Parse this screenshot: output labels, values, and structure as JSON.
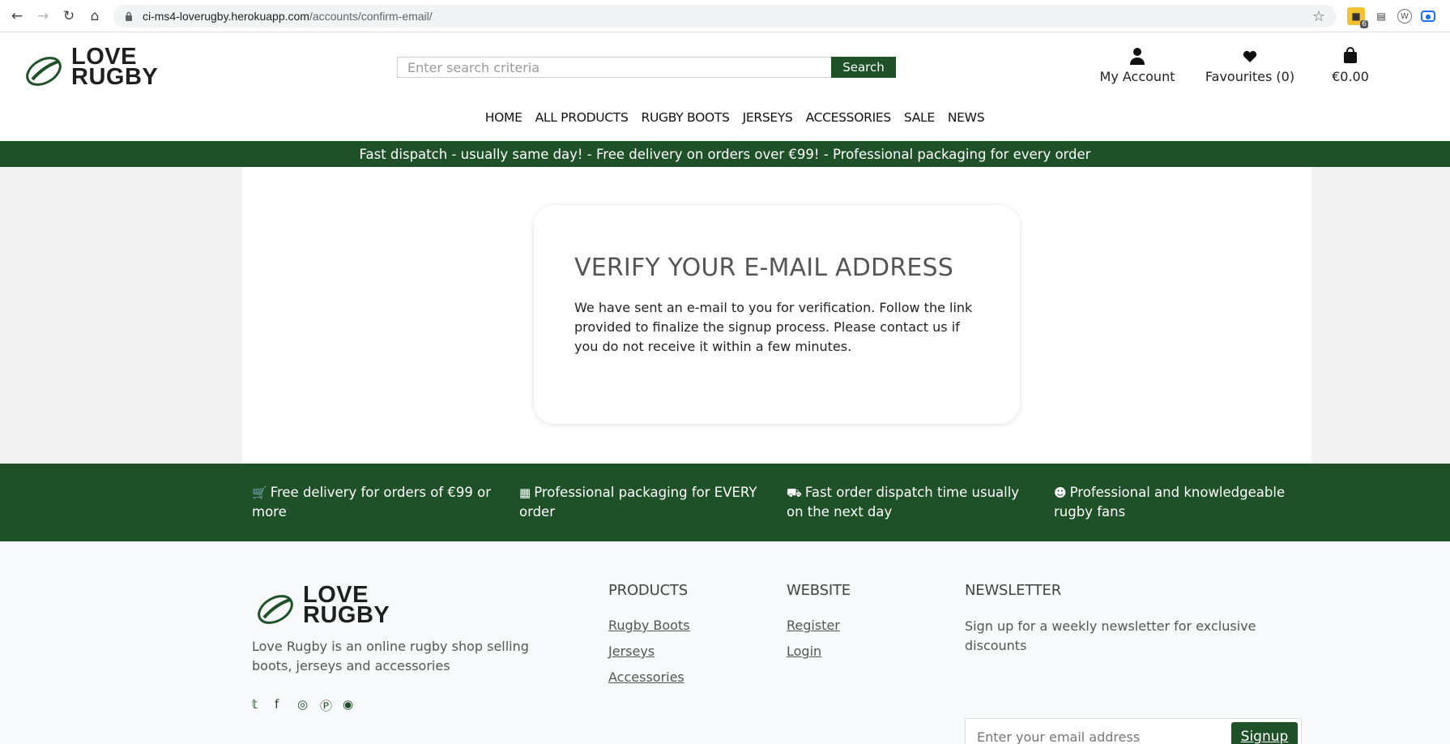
{
  "browser": {
    "url_host": "ci-ms4-loverugby.herokuapp.com",
    "url_path": "/accounts/confirm-email/",
    "ext_badge": "6"
  },
  "brand": {
    "line1": "LOVE",
    "line2": "RUGBY",
    "primary_color": "#1f5128"
  },
  "header": {
    "search_placeholder": "Enter search criteria",
    "search_button": "Search",
    "account_label": "My Account",
    "favourites_label": "Favourites (0)",
    "cart_label": "€0.00"
  },
  "nav": {
    "items": [
      "HOME",
      "ALL PRODUCTS",
      "RUGBY BOOTS",
      "JERSEYS",
      "ACCESSORIES",
      "SALE",
      "NEWS"
    ]
  },
  "promo": {
    "text": "Fast dispatch - usually same day! - Free delivery on orders over €99! - Professional packaging for every order"
  },
  "verify": {
    "title": "VERIFY YOUR E-MAIL ADDRESS",
    "body": "We have sent an e-mail to you for verification. Follow the link provided to finalize the signup process. Please contact us if you do not receive it within a few minutes."
  },
  "features": [
    {
      "icon": "cart-icon",
      "text": "Free delivery for orders of €99 or more"
    },
    {
      "icon": "box-icon",
      "text": "Professional packaging for EVERY order"
    },
    {
      "icon": "truck-icon",
      "text": "Fast order dispatch time usually on the next day"
    },
    {
      "icon": "smile-icon",
      "text": "Professional and knowledgeable rugby fans"
    }
  ],
  "footer": {
    "about": "Love Rugby is an online rugby shop selling boots, jerseys and accessories",
    "products_heading": "PRODUCTS",
    "products_links": [
      "Rugby Boots",
      "Jerseys",
      "Accessories"
    ],
    "website_heading": "WEBSITE",
    "website_links": [
      "Register",
      "Login"
    ],
    "newsletter_heading": "NEWSLETTER",
    "newsletter_text": "Sign up for a weekly newsletter for exclusive discounts",
    "newsletter_placeholder": "Enter your email address",
    "newsletter_button": "Signup",
    "social": [
      "twitter-icon",
      "facebook-icon",
      "instagram-icon",
      "pinterest-icon",
      "snapchat-icon"
    ]
  }
}
